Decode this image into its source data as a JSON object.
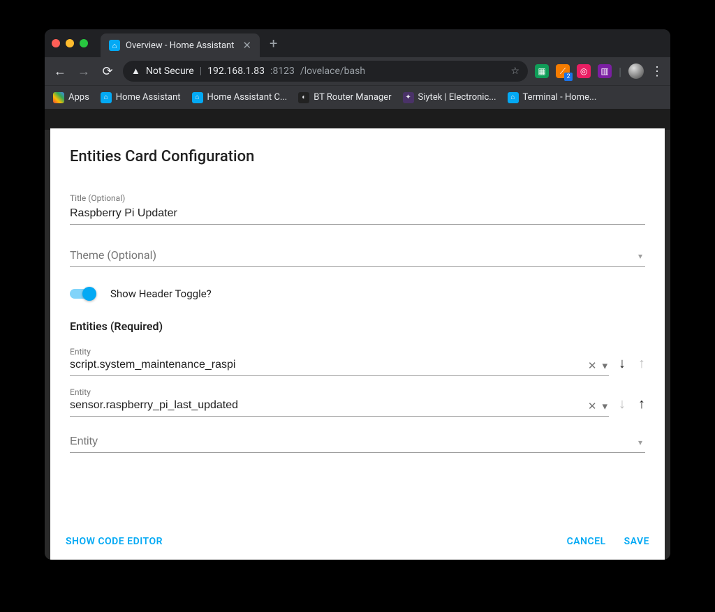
{
  "browser": {
    "tab_title": "Overview - Home Assistant",
    "not_secure_label": "Not Secure",
    "url_host": "192.168.1.83",
    "url_port": ":8123",
    "url_path": "/lovelace/bash",
    "rss_badge": "2"
  },
  "bookmarks": {
    "apps": "Apps",
    "items": [
      {
        "label": "Home Assistant"
      },
      {
        "label": "Home Assistant C..."
      },
      {
        "label": "BT Router Manager"
      },
      {
        "label": "Siytek | Electronic..."
      },
      {
        "label": "Terminal - Home..."
      }
    ]
  },
  "dialog": {
    "title": "Entities Card Configuration",
    "title_field_label": "Title (Optional)",
    "title_value": "Raspberry Pi Updater",
    "theme_label": "Theme (Optional)",
    "toggle_label": "Show Header Toggle?",
    "entities_section": "Entities (Required)",
    "entity_label": "Entity",
    "entities": [
      {
        "value": "script.system_maintenance_raspi"
      },
      {
        "value": "sensor.raspberry_pi_last_updated"
      }
    ],
    "empty_entity_placeholder": "Entity",
    "show_code_editor": "Show Code Editor",
    "cancel": "Cancel",
    "save": "Save"
  }
}
